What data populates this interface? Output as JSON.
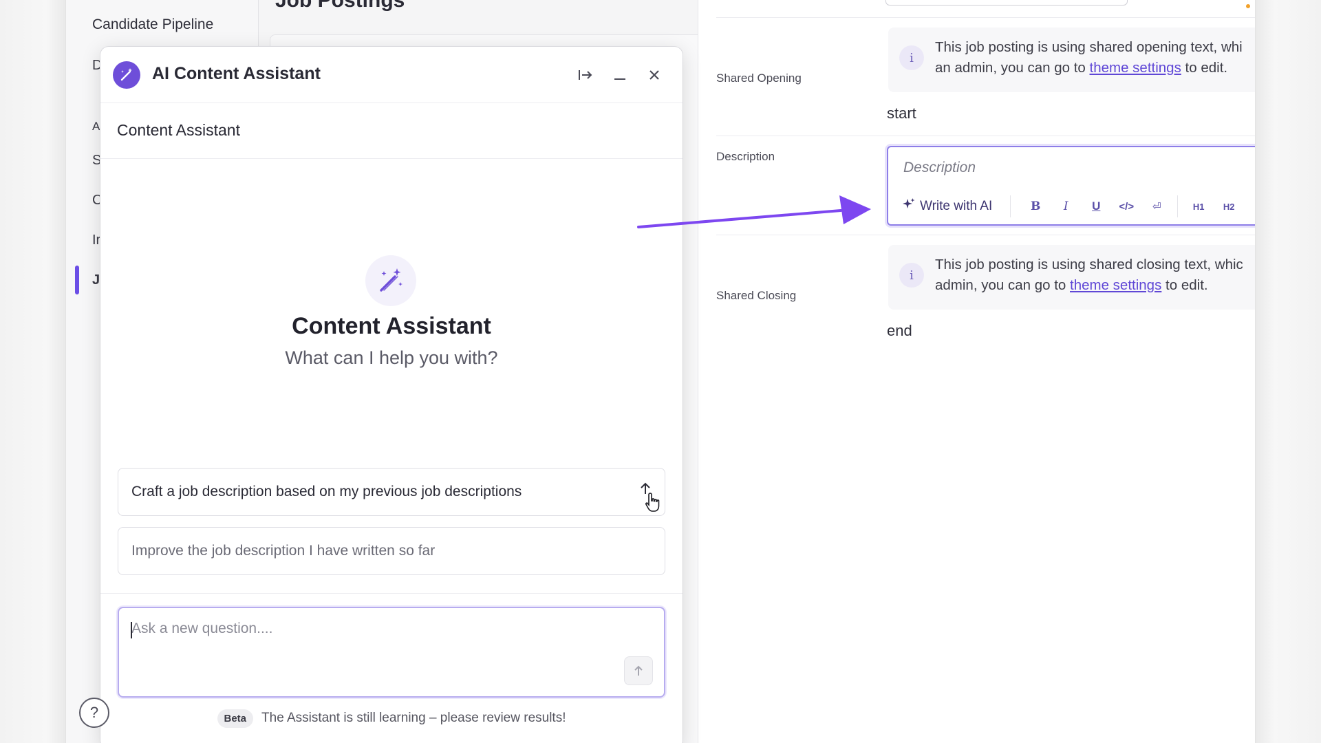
{
  "left_nav": {
    "title": "Candidate Pipeline",
    "letters": [
      "D",
      "A",
      "S",
      "C",
      "Ir",
      "J"
    ],
    "page_heading": "Job Postings"
  },
  "panel": {
    "title": "AI Content Assistant",
    "subheader": "Content Assistant",
    "hero_title": "Content Assistant",
    "hero_subtitle": "What can I help you with?",
    "suggestions": [
      "Craft a job description based on my previous job descriptions",
      "Improve the job description I have written so far"
    ],
    "ask_placeholder": "Ask a new question....",
    "beta_label": "Beta",
    "footer_note": "The Assistant is still learning – please review results!",
    "help_label": "?"
  },
  "form": {
    "shared_opening": {
      "label": "Shared Opening",
      "info_line1": "This job posting is using shared opening text, whi",
      "info_line2_prefix": "an admin, you can go to ",
      "link": "theme settings",
      "info_line2_suffix": " to edit.",
      "value": "start"
    },
    "description": {
      "label": "Description",
      "placeholder": "Description",
      "write_ai": "Write with AI",
      "toolbar": [
        "B",
        "I",
        "U",
        "</>",
        "⏎",
        "H1",
        "H2"
      ]
    },
    "shared_closing": {
      "label": "Shared Closing",
      "info_line1": "This job posting is using shared closing text, whic",
      "info_line2_prefix": "admin, you can go to ",
      "link": "theme settings",
      "info_line2_suffix": " to edit.",
      "value": "end"
    }
  },
  "colors": {
    "accent": "#6e4ed9",
    "arrow": "#7d47f0",
    "link": "#5f47d6"
  }
}
